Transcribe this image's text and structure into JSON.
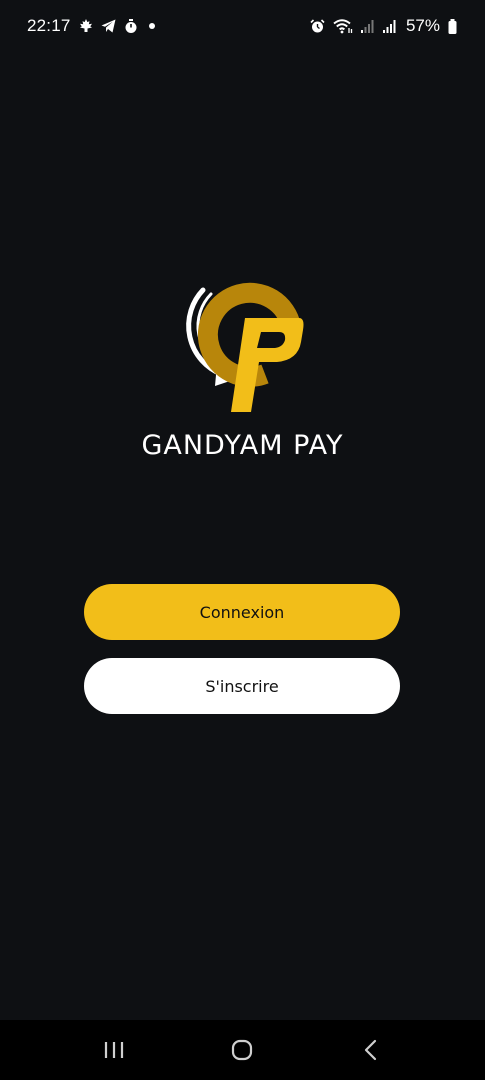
{
  "status_bar": {
    "time": "22:17",
    "battery_percent": "57%",
    "left_icons": [
      "maple-leaf-icon",
      "telegram-icon",
      "stopwatch-icon",
      "notification-dot-icon"
    ],
    "right_icons": [
      "alarm-icon",
      "wifi-icon",
      "signal-icon",
      "signal-icon",
      "battery-icon"
    ]
  },
  "brand": {
    "name": "GANDYAM PAY",
    "logo": "gandyam-pay-logo",
    "accent_color": "#f2be19",
    "dark_gold": "#b8860b"
  },
  "actions": {
    "login_label": "Connexion",
    "signup_label": "S'inscrire"
  },
  "nav_bar": {
    "buttons": [
      "recent-apps-icon",
      "home-icon",
      "back-icon"
    ]
  }
}
